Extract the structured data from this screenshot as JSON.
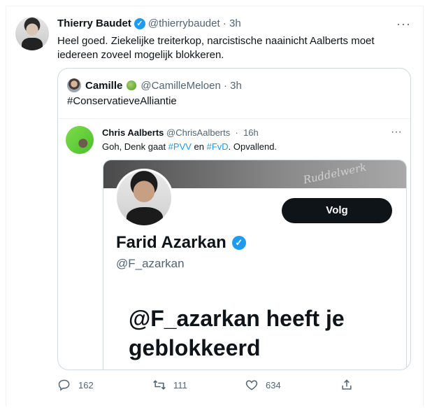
{
  "tweet": {
    "author_name": "Thierry Baudet",
    "author_handle": "@thierrybaudet",
    "time": "3h",
    "text": "Heel goed. Ziekelijke treiterkop, narcistische naainicht Aalberts moet iedereen zoveel mogelijk blokkeren.",
    "more_label": "···"
  },
  "quote": {
    "author_name": "Camille",
    "author_handle": "@CamilleMeloen",
    "time": "3h",
    "text": "#ConservatieveAlliantie",
    "inner": {
      "author_name": "Chris Aalberts",
      "author_handle": "@ChrisAalberts",
      "time": "16h",
      "more_label": "···",
      "text_before": "Goh, Denk gaat ",
      "hashtag1": "#PVV",
      "text_middle": " en ",
      "hashtag2": "#FvD",
      "text_after": ". Opvallend.",
      "profile": {
        "follow_label": "Volg",
        "name": "Farid Azarkan",
        "handle": "@F_azarkan",
        "blocked_message": "@F_azarkan heeft je geblokkeerd",
        "banner_scribble": "Ruddelwerk"
      }
    }
  },
  "actions": {
    "reply_count": "162",
    "retweet_count": "111",
    "like_count": "634"
  },
  "colors": {
    "accent": "#1d9bf0",
    "muted": "#536471",
    "text": "#0f1419",
    "border": "#cfd9de"
  },
  "icons": [
    "verified-badge-icon",
    "more-icon",
    "lettuce-emoji-icon",
    "reply-icon",
    "retweet-icon",
    "like-icon",
    "share-icon"
  ]
}
